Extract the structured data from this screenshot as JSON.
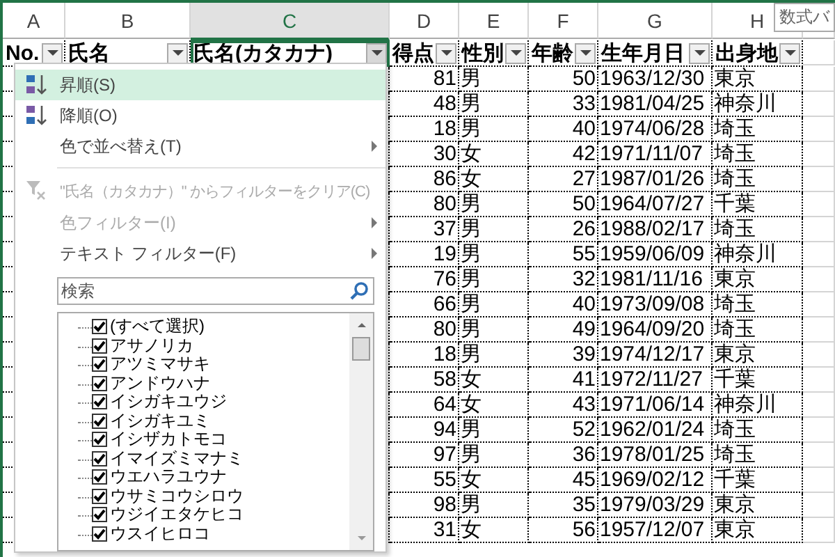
{
  "formula_bar_tip": "数式バ",
  "column_headers": [
    {
      "label": "A",
      "selected": false
    },
    {
      "label": "B",
      "selected": false
    },
    {
      "label": "C",
      "selected": true
    },
    {
      "label": "D",
      "selected": false
    },
    {
      "label": "E",
      "selected": false
    },
    {
      "label": "F",
      "selected": false
    },
    {
      "label": "G",
      "selected": false
    },
    {
      "label": "H",
      "selected": false
    }
  ],
  "table": {
    "columns": [
      {
        "label": "No.",
        "filter_open": false
      },
      {
        "label": "氏名",
        "filter_open": false
      },
      {
        "label": "氏名(カタカナ)",
        "filter_open": true
      },
      {
        "label": "得点",
        "filter_open": false
      },
      {
        "label": "性別",
        "filter_open": false
      },
      {
        "label": "年齢",
        "filter_open": false
      },
      {
        "label": "生年月日",
        "filter_open": false
      },
      {
        "label": "出身地",
        "filter_open": false
      }
    ],
    "rows": [
      {
        "score": "81",
        "sex": "男",
        "age": "50",
        "birth": "1963/12/30",
        "home": "東京"
      },
      {
        "score": "48",
        "sex": "男",
        "age": "33",
        "birth": "1981/04/25",
        "home": "神奈川"
      },
      {
        "score": "18",
        "sex": "男",
        "age": "40",
        "birth": "1974/06/28",
        "home": "埼玉"
      },
      {
        "score": "30",
        "sex": "女",
        "age": "42",
        "birth": "1971/11/07",
        "home": "埼玉"
      },
      {
        "score": "86",
        "sex": "女",
        "age": "27",
        "birth": "1987/01/26",
        "home": "埼玉"
      },
      {
        "score": "80",
        "sex": "男",
        "age": "50",
        "birth": "1964/07/27",
        "home": "千葉"
      },
      {
        "score": "37",
        "sex": "男",
        "age": "26",
        "birth": "1988/02/17",
        "home": "埼玉"
      },
      {
        "score": "19",
        "sex": "男",
        "age": "55",
        "birth": "1959/06/09",
        "home": "神奈川"
      },
      {
        "score": "76",
        "sex": "男",
        "age": "32",
        "birth": "1981/11/16",
        "home": "東京"
      },
      {
        "score": "66",
        "sex": "男",
        "age": "40",
        "birth": "1973/09/08",
        "home": "埼玉"
      },
      {
        "score": "80",
        "sex": "男",
        "age": "49",
        "birth": "1964/09/20",
        "home": "埼玉"
      },
      {
        "score": "18",
        "sex": "男",
        "age": "39",
        "birth": "1974/12/17",
        "home": "東京"
      },
      {
        "score": "58",
        "sex": "女",
        "age": "41",
        "birth": "1972/11/27",
        "home": "千葉"
      },
      {
        "score": "64",
        "sex": "女",
        "age": "43",
        "birth": "1971/06/14",
        "home": "神奈川"
      },
      {
        "score": "94",
        "sex": "男",
        "age": "52",
        "birth": "1962/01/24",
        "home": "埼玉"
      },
      {
        "score": "97",
        "sex": "男",
        "age": "36",
        "birth": "1978/01/25",
        "home": "埼玉"
      },
      {
        "score": "55",
        "sex": "女",
        "age": "45",
        "birth": "1969/02/12",
        "home": "千葉"
      },
      {
        "score": "98",
        "sex": "男",
        "age": "35",
        "birth": "1979/03/29",
        "home": "東京"
      },
      {
        "score": "31",
        "sex": "女",
        "age": "56",
        "birth": "1957/12/07",
        "home": "東京"
      }
    ]
  },
  "filter_menu": {
    "items": [
      {
        "kind": "ascending",
        "label": "昇順(S)",
        "highlighted": true,
        "disabled": false
      },
      {
        "kind": "descending",
        "label": "降順(O)",
        "highlighted": false,
        "disabled": false
      },
      {
        "kind": "submenu",
        "label": "色で並べ替え(T)",
        "highlighted": false,
        "disabled": false
      },
      {
        "kind": "separator"
      },
      {
        "kind": "clear",
        "label": "\"氏名（カタカナ）\" からフィルターをクリア(C)",
        "highlighted": false,
        "disabled": true
      },
      {
        "kind": "submenu",
        "label": "色フィルター(I)",
        "highlighted": false,
        "disabled": true
      },
      {
        "kind": "submenu",
        "label": "テキスト フィルター(F)",
        "highlighted": false,
        "disabled": false
      }
    ],
    "search": {
      "placeholder": "検索"
    },
    "list": [
      {
        "label": "(すべて選択)",
        "checked": true
      },
      {
        "label": "アサノリカ",
        "checked": true
      },
      {
        "label": "アツミマサキ",
        "checked": true
      },
      {
        "label": "アンドウハナ",
        "checked": true
      },
      {
        "label": "イシガキユウジ",
        "checked": true
      },
      {
        "label": "イシガキユミ",
        "checked": true
      },
      {
        "label": "イシザカトモコ",
        "checked": true
      },
      {
        "label": "イマイズミマナミ",
        "checked": true
      },
      {
        "label": "ウエハラユウナ",
        "checked": true
      },
      {
        "label": "ウサミコウシロウ",
        "checked": true
      },
      {
        "label": "ウジイエタケヒコ",
        "checked": true
      },
      {
        "label": "ウスイヒロコ",
        "checked": true
      }
    ]
  }
}
